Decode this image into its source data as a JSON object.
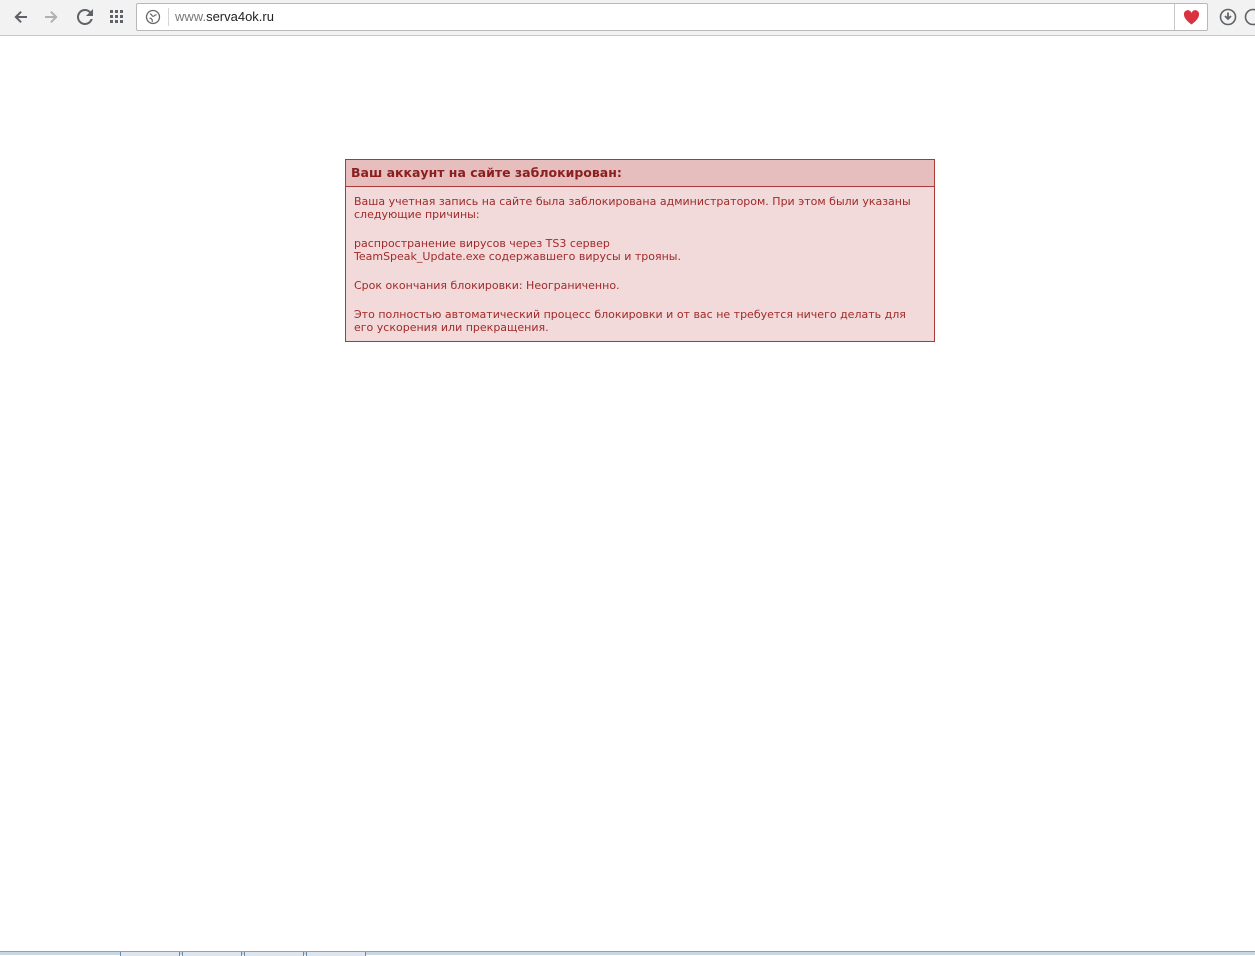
{
  "browser": {
    "address": {
      "url_prefix": "www.",
      "url_host": "serva4ok.ru"
    },
    "icons": {
      "back": "back-arrow-icon",
      "forward": "forward-arrow-icon",
      "reload": "reload-icon",
      "apps": "grid-icon",
      "site_info": "globe-icon",
      "bookmark": "heart-icon",
      "download": "download-icon"
    },
    "colors": {
      "heart": "#d9333f",
      "toolbar": "#f2f2f2"
    }
  },
  "notice": {
    "title": "Ваш аккаунт на сайте заблокирован:",
    "intro": "Ваша учетная запись на сайте была заблокирована администратором. При этом были указаны следующие причины:",
    "reason_line1": "распространение вирусов через TS3 сервер",
    "reason_line2": "TeamSpeak_Update.exe содержавшего вирусы и трояны.",
    "expiry": "Срок окончания блокировки: Неограниченно.",
    "footer": "Это полностью автоматический процесс блокировки и от вас не требуется ничего делать для его ускорения или прекращения.",
    "colors": {
      "border": "#a83a3a",
      "background": "#f2dada",
      "header_bg": "#e6bebe",
      "text": "#a12a2a"
    }
  }
}
